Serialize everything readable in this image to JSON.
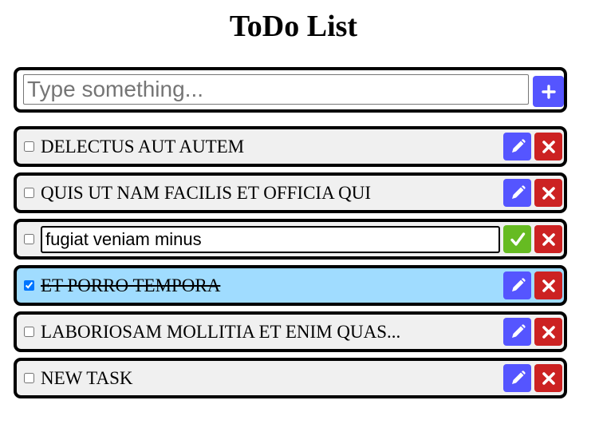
{
  "title": "ToDo List",
  "new_task": {
    "placeholder": "Type something..."
  },
  "tasks": [
    {
      "text": "delectus aut autem",
      "done": false,
      "editing": false
    },
    {
      "text": "quis ut nam facilis et officia qui",
      "done": false,
      "editing": false
    },
    {
      "text": "fugiat veniam minus",
      "done": false,
      "editing": true
    },
    {
      "text": "et porro tempora",
      "done": true,
      "editing": false
    },
    {
      "text": "laboriosam mollitia et enim quas...",
      "done": false,
      "editing": false
    },
    {
      "text": "New task",
      "done": false,
      "editing": false
    }
  ],
  "icons": {
    "add": "plus-icon",
    "edit": "pencil-icon",
    "delete": "x-icon",
    "save": "checkmark-icon"
  },
  "colors": {
    "add_button": "#5555ff",
    "edit_button": "#5555ff",
    "delete_button": "#cc2222",
    "save_button": "#66bb22",
    "item_background": "#f0f0f0",
    "done_item_background": "#a0dcff"
  }
}
